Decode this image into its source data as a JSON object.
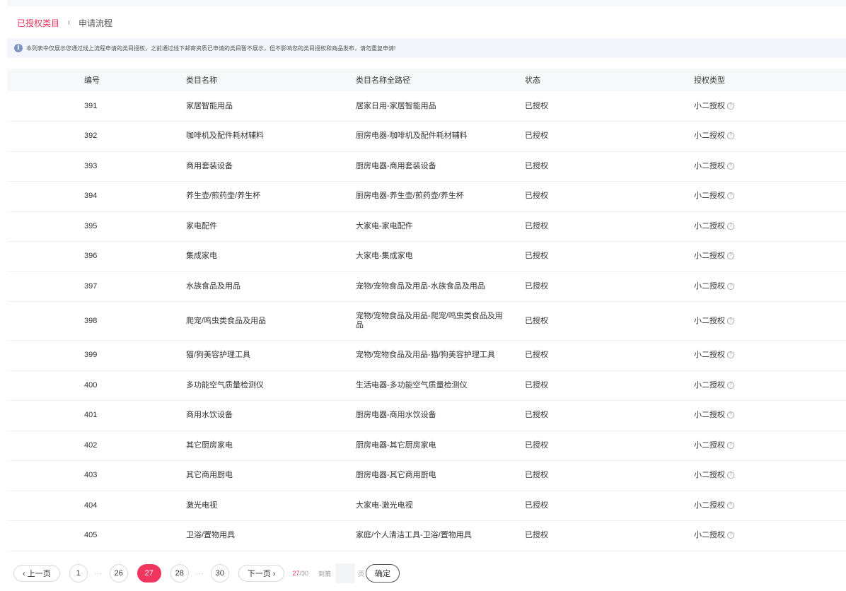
{
  "tabs": {
    "authorized": "已授权类目",
    "process": "申请流程"
  },
  "notice": {
    "icon": "info-icon",
    "text": "本列表中仅展示您通过线上流程申请的类目授权，之前通过线下邮寄资质已申请的类目暂不展示，但不影响您的类目授权和商品发布，请勿重复申请!"
  },
  "table": {
    "headers": [
      "编号",
      "类目名称",
      "类目名称全路径",
      "状态",
      "授权类型"
    ],
    "rows": [
      {
        "id": "391",
        "name": "家居智能用品",
        "path": "居家日用-家居智能用品",
        "status": "已授权",
        "type": "小二授权"
      },
      {
        "id": "392",
        "name": "咖啡机及配件耗材辅料",
        "path": "厨房电器-咖啡机及配件耗材辅料",
        "status": "已授权",
        "type": "小二授权"
      },
      {
        "id": "393",
        "name": "商用套装设备",
        "path": "厨房电器-商用套装设备",
        "status": "已授权",
        "type": "小二授权"
      },
      {
        "id": "394",
        "name": "养生壶/煎药壶/养生杯",
        "path": "厨房电器-养生壶/煎药壶/养生杯",
        "status": "已授权",
        "type": "小二授权"
      },
      {
        "id": "395",
        "name": "家电配件",
        "path": "大家电-家电配件",
        "status": "已授权",
        "type": "小二授权"
      },
      {
        "id": "396",
        "name": "集成家电",
        "path": "大家电-集成家电",
        "status": "已授权",
        "type": "小二授权"
      },
      {
        "id": "397",
        "name": "水族食品及用品",
        "path": "宠物/宠物食品及用品-水族食品及用品",
        "status": "已授权",
        "type": "小二授权"
      },
      {
        "id": "398",
        "name": "爬宠/鸣虫类食品及用品",
        "path": "宠物/宠物食品及用品-爬宠/鸣虫类食品及用品",
        "status": "已授权",
        "type": "小二授权"
      },
      {
        "id": "399",
        "name": "猫/狗美容护理工具",
        "path": "宠物/宠物食品及用品-猫/狗美容护理工具",
        "status": "已授权",
        "type": "小二授权"
      },
      {
        "id": "400",
        "name": "多功能空气质量检测仪",
        "path": "生活电器-多功能空气质量检测仪",
        "status": "已授权",
        "type": "小二授权"
      },
      {
        "id": "401",
        "name": "商用水饮设备",
        "path": "厨房电器-商用水饮设备",
        "status": "已授权",
        "type": "小二授权"
      },
      {
        "id": "402",
        "name": "其它厨房家电",
        "path": "厨房电器-其它厨房家电",
        "status": "已授权",
        "type": "小二授权"
      },
      {
        "id": "403",
        "name": "其它商用厨电",
        "path": "厨房电器-其它商用厨电",
        "status": "已授权",
        "type": "小二授权"
      },
      {
        "id": "404",
        "name": "激光电视",
        "path": "大家电-激光电视",
        "status": "已授权",
        "type": "小二授权"
      },
      {
        "id": "405",
        "name": "卫浴/置物用具",
        "path": "家庭/个人清洁工具-卫浴/置物用具",
        "status": "已授权",
        "type": "小二授权"
      }
    ]
  },
  "pager": {
    "prev": "‹ 上一页",
    "next": "下一页 ›",
    "pages": [
      "1",
      "26",
      "27",
      "28",
      "30"
    ],
    "ellipsis": "···",
    "current": "27",
    "total": "/30",
    "goto_label": "到第",
    "page_label": "页",
    "confirm": "确定"
  }
}
